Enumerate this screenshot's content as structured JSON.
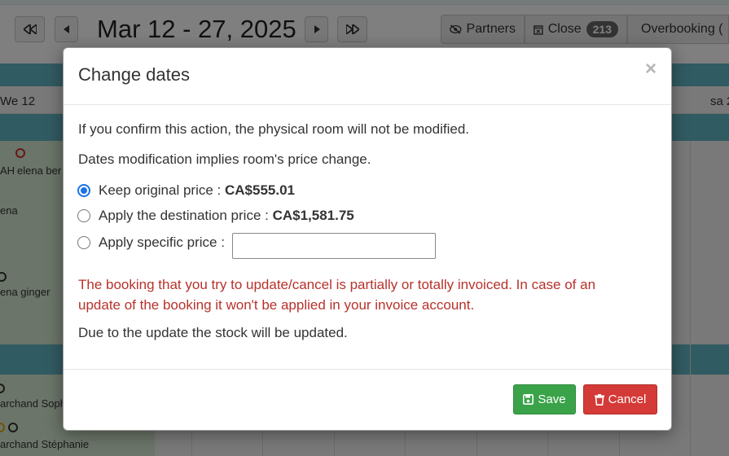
{
  "toolbar": {
    "date_range": "Mar 12 - 27, 2025",
    "partners_label": "Partners",
    "close_label": "Close",
    "close_count": "213",
    "overbooking_label": "Overbooking ("
  },
  "calendar": {
    "day_left": "We 12",
    "day_right": "sa 2",
    "guests": [
      "elena ber",
      "AH",
      "ena",
      "ena ginger",
      "archand Soph",
      "archand Stéphanie"
    ]
  },
  "modal": {
    "title": "Change dates",
    "close_symbol": "×",
    "line1": "If you confirm this action, the physical room will not be modified.",
    "line2": "Dates modification implies room's price change.",
    "options": [
      {
        "label": "Keep original price : ",
        "value": "CA$555.01",
        "checked": true
      },
      {
        "label": "Apply the destination price : ",
        "value": "CA$1,581.75",
        "checked": false
      },
      {
        "label": "Apply specific price : ",
        "value": "",
        "checked": false
      }
    ],
    "specific_price_value": "",
    "warning": "The booking that you try to update/cancel is partially or totally invoiced. In case of an update of the booking it won't be applied in your invoice account.",
    "stock_note": "Due to the update the stock will be updated.",
    "save_label": "Save",
    "cancel_label": "Cancel"
  },
  "colors": {
    "band": "#62b7c5",
    "save": "#3aa34a",
    "cancel": "#d43a37",
    "warning": "#b8322b",
    "radio_checked": "#1a73e8"
  }
}
